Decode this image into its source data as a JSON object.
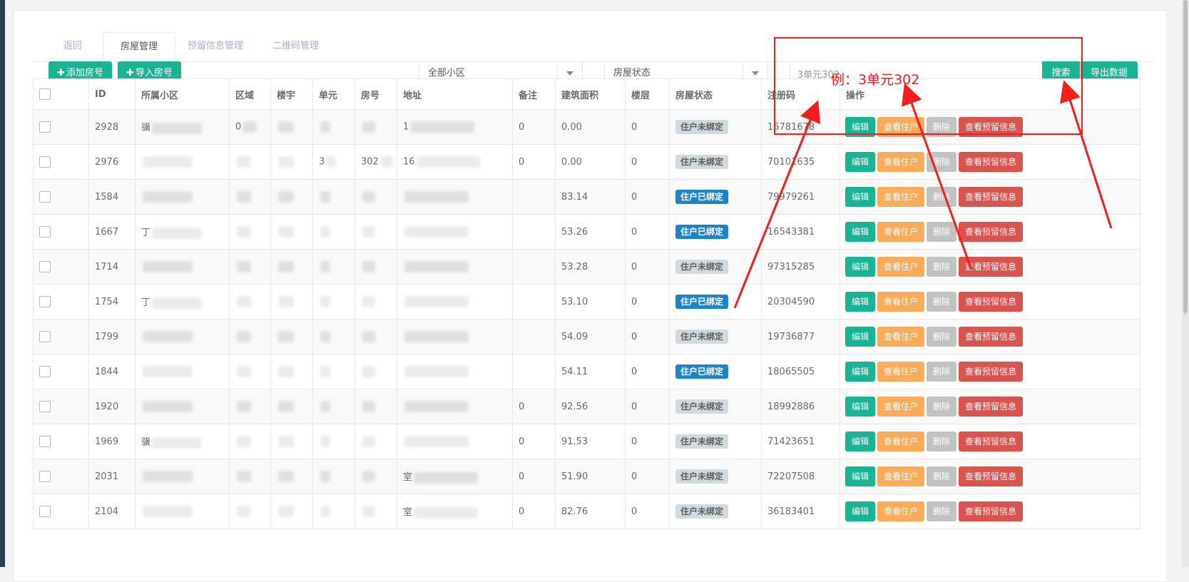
{
  "tabs": [
    {
      "label": "返回"
    },
    {
      "label": "房屋管理"
    },
    {
      "label": "预留信息管理"
    },
    {
      "label": "二维码管理"
    }
  ],
  "toolbar": {
    "add_label": "添加房号",
    "import_label": "导入房号",
    "community_select": "全部小区",
    "status_select": "房屋状态",
    "search_value": "3单元302",
    "search_label": "搜索",
    "export_label": "导出数据"
  },
  "table": {
    "headers": [
      "ID",
      "所属小区",
      "区域",
      "楼宇",
      "单元",
      "房号",
      "地址",
      "备注",
      "建筑面积",
      "楼层",
      "房屋状态",
      "注册码",
      "操作"
    ],
    "rows": [
      {
        "id": "2928",
        "community": "骥",
        "area": "0",
        "building": "",
        "unit": "",
        "room": "",
        "address": "1",
        "note": "0",
        "size": "0.00",
        "floor": "0",
        "status": "住户未绑定",
        "status_type": "gray",
        "code": "16781678"
      },
      {
        "id": "2976",
        "community": "",
        "area": "",
        "building": "",
        "unit": "3",
        "room": "302",
        "address": "16",
        "note": "0",
        "size": "0.00",
        "floor": "0",
        "status": "住户未绑定",
        "status_type": "gray",
        "code": "70101635"
      },
      {
        "id": "1584",
        "community": "",
        "area": "",
        "building": "",
        "unit": "",
        "room": "",
        "address": "",
        "note": "",
        "size": "83.14",
        "floor": "0",
        "status": "住户已绑定",
        "status_type": "blue",
        "code": "79979261"
      },
      {
        "id": "1667",
        "community": "丁",
        "area": "",
        "building": "",
        "unit": "",
        "room": "",
        "address": "",
        "note": "",
        "size": "53.26",
        "floor": "0",
        "status": "住户已绑定",
        "status_type": "blue",
        "code": "16543381"
      },
      {
        "id": "1714",
        "community": "",
        "area": "",
        "building": "",
        "unit": "",
        "room": "",
        "address": "",
        "note": "",
        "size": "53.28",
        "floor": "0",
        "status": "住户未绑定",
        "status_type": "gray",
        "code": "97315285"
      },
      {
        "id": "1754",
        "community": "丁",
        "area": "",
        "building": "",
        "unit": "",
        "room": "",
        "address": "",
        "note": "",
        "size": "53.10",
        "floor": "0",
        "status": "住户已绑定",
        "status_type": "blue",
        "code": "20304590"
      },
      {
        "id": "1799",
        "community": "",
        "area": "",
        "building": "",
        "unit": "",
        "room": "",
        "address": "",
        "note": "",
        "size": "54.09",
        "floor": "0",
        "status": "住户未绑定",
        "status_type": "gray",
        "code": "19736877"
      },
      {
        "id": "1844",
        "community": "",
        "area": "",
        "building": "",
        "unit": "",
        "room": "",
        "address": "",
        "note": "",
        "size": "54.11",
        "floor": "0",
        "status": "住户已绑定",
        "status_type": "blue",
        "code": "18065505"
      },
      {
        "id": "1920",
        "community": "",
        "area": "",
        "building": "",
        "unit": "",
        "room": "",
        "address": "",
        "note": "0",
        "size": "92.56",
        "floor": "0",
        "status": "住户未绑定",
        "status_type": "gray",
        "code": "18992886"
      },
      {
        "id": "1969",
        "community": "骥",
        "area": "",
        "building": "",
        "unit": "",
        "room": "",
        "address": "",
        "note": "0",
        "size": "91.53",
        "floor": "0",
        "status": "住户未绑定",
        "status_type": "gray",
        "code": "71423651"
      },
      {
        "id": "2031",
        "community": "",
        "area": "",
        "building": "",
        "unit": "",
        "room": "",
        "address": "室",
        "note": "0",
        "size": "51.90",
        "floor": "0",
        "status": "住户未绑定",
        "status_type": "gray",
        "code": "72207508"
      },
      {
        "id": "2104",
        "community": "",
        "area": "",
        "building": "",
        "unit": "",
        "room": "",
        "address": "室",
        "note": "0",
        "size": "82.76",
        "floor": "0",
        "status": "住户未绑定",
        "status_type": "gray",
        "code": "36183401"
      }
    ],
    "actions": {
      "edit": "编辑",
      "view": "查看住户",
      "delete": "删除",
      "reserve": "查看预留信息"
    }
  },
  "annotation": {
    "text": "例：3单元302"
  },
  "colors": {
    "primary": "#1ab394",
    "warning": "#f8ac59",
    "danger": "#d9534f",
    "info": "#1c84c6",
    "annotation": "#f21d1d"
  }
}
